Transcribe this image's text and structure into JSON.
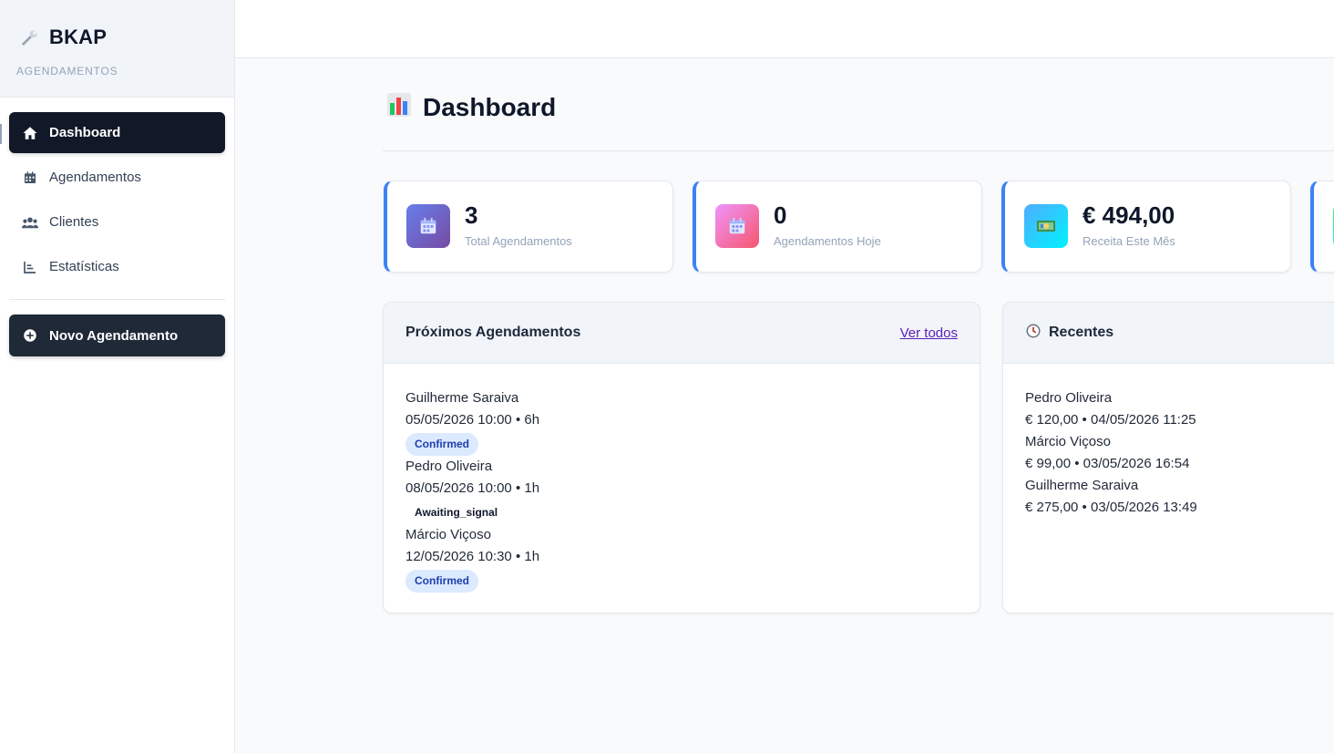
{
  "brand": {
    "title": "BKAP",
    "subtitle": "AGENDAMENTOS",
    "icon": "wrench-icon"
  },
  "nav": {
    "items": [
      {
        "label": "Dashboard",
        "icon": "home-icon",
        "active": true
      },
      {
        "label": "Agendamentos",
        "icon": "calendar-icon",
        "active": false
      },
      {
        "label": "Clientes",
        "icon": "users-icon",
        "active": false
      },
      {
        "label": "Estatísticas",
        "icon": "chart-icon",
        "active": false
      }
    ],
    "new_button": "Novo Agendamento"
  },
  "page": {
    "title": "Dashboard",
    "icon": "bar-chart-icon"
  },
  "stats": [
    {
      "value": "3",
      "label": "Total Agendamentos",
      "icon": "calendar-icon",
      "gradient": [
        "#667eea",
        "#764ba2"
      ]
    },
    {
      "value": "0",
      "label": "Agendamentos Hoje",
      "icon": "calendar-icon",
      "gradient": [
        "#f093fb",
        "#f5576c"
      ]
    },
    {
      "value": "€ 494,00",
      "label": "Receita Este Mês",
      "icon": "money-icon",
      "gradient": [
        "#4facfe",
        "#00f2fe"
      ]
    }
  ],
  "upcoming": {
    "title": "Próximos Agendamentos",
    "link": "Ver todos",
    "items": [
      {
        "name": "Guilherme Saraiva",
        "when": "05/05/2026 10:00 • 6h",
        "status": "Confirmed"
      },
      {
        "name": "Pedro Oliveira",
        "when": "08/05/2026 10:00 • 1h",
        "status": "Awaiting_signal"
      },
      {
        "name": "Márcio Viçoso",
        "when": "12/05/2026 10:30 • 1h",
        "status": "Confirmed"
      }
    ]
  },
  "recent": {
    "title": "Recentes",
    "icon": "clock-icon",
    "items": [
      {
        "name": "Pedro Oliveira",
        "detail": "€ 120,00 • 04/05/2026 11:25"
      },
      {
        "name": "Márcio Viçoso",
        "detail": "€ 99,00 • 03/05/2026 16:54"
      },
      {
        "name": "Guilherme Saraiva",
        "detail": "€ 275,00 • 03/05/2026 13:49"
      }
    ]
  },
  "colors": {
    "accent": "#3b82f6",
    "nav_active": "#111827",
    "link": "#5b21b6"
  }
}
